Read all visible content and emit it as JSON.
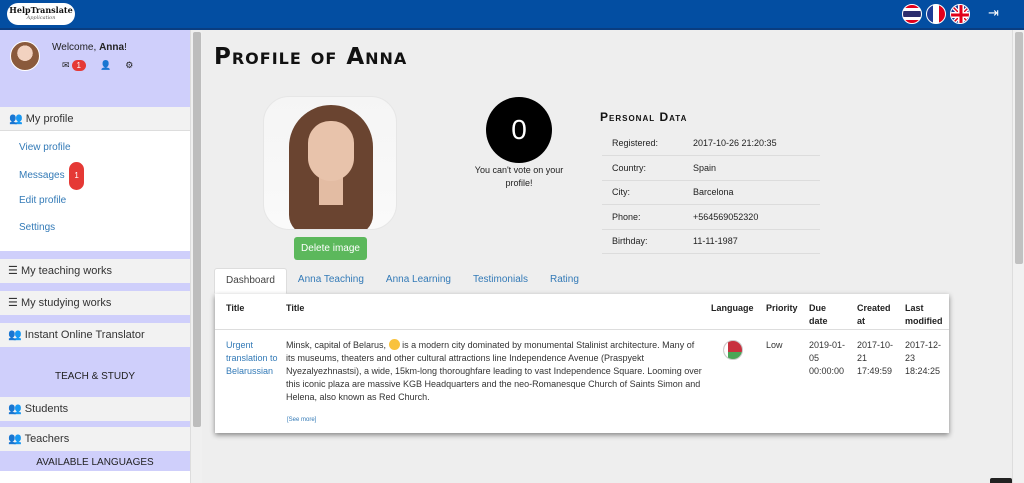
{
  "app": {
    "logo_line1": "HelpTranslate",
    "logo_line2": "Application",
    "languages": [
      "thai-flag-icon",
      "france-flag-icon",
      "uk-flag-icon"
    ],
    "accent_color": "#034ea2",
    "sidebar_color": "#cfcffb"
  },
  "user": {
    "welcome_prefix": "Welcome, ",
    "name": "Anna",
    "welcome_suffix": "!",
    "message_count": "1"
  },
  "sidebar": {
    "my_profile": "My profile",
    "links": [
      "View profile",
      "Messages",
      "Edit profile",
      "Settings"
    ],
    "messages_badge": "1",
    "teaching": "My teaching works",
    "studying": "My studying works",
    "instant": "Instant Online Translator",
    "teach_study": "TEACH & STUDY",
    "students": "Students",
    "teachers": "Teachers",
    "available_languages": "AVAILABLE LANGUAGES"
  },
  "profile": {
    "title": "Profile of Anna",
    "delete_button": "Delete image",
    "votes": "0",
    "vote_note": "You can't vote on your profile!"
  },
  "personal": {
    "title": "Personal Data",
    "rows": [
      {
        "k": "Registered:",
        "v": "2017-10-26 21:20:35"
      },
      {
        "k": "Country:",
        "v": "Spain"
      },
      {
        "k": "City:",
        "v": "Barcelona"
      },
      {
        "k": "Phone:",
        "v": "+564569052320"
      },
      {
        "k": "Birthday:",
        "v": "11-11-1987"
      }
    ]
  },
  "tabs": [
    "Dashboard",
    "Anna Teaching",
    "Anna Learning",
    "Testimonials",
    "Rating"
  ],
  "table": {
    "headers": {
      "title1": "Title",
      "title2": "Title",
      "language": "Language",
      "priority": "Priority",
      "due": "Due date",
      "created": "Created at",
      "modified": "Last modified"
    },
    "row": {
      "link": "Urgent translation to Belarussian",
      "text_before": "Minsk, capital of Belarus,",
      "text_after": " is a modern city dominated by monumental Stalinist architecture. Many of its museums, theaters and other cultural attractions line Independence Avenue (Praspyekt Nyezalyezhnastsi), a wide, 15km-long thoroughfare leading to vast Independence Square. Looming over this iconic plaza are massive KGB Headquarters and the neo-Romanesque Church of Saints Simon and Helena, also known as Red Church.",
      "language_icon": "belarus-flag-icon",
      "priority": "Low",
      "due": "2019-01-05 00:00:00",
      "created": "2017-10-21 17:49:59",
      "modified": "2017-12-23 18:24:25",
      "see_more": "[See more]"
    }
  }
}
